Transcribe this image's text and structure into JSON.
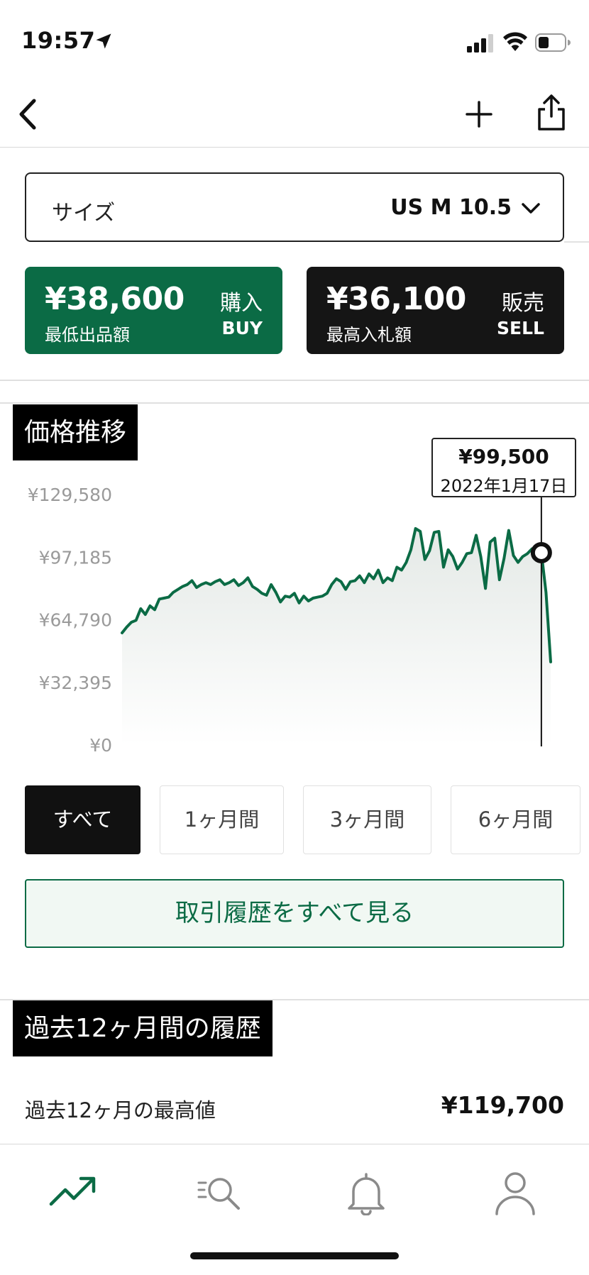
{
  "status_bar": {
    "time": "19:57"
  },
  "size_selector": {
    "label": "サイズ",
    "value": "US M 10.5"
  },
  "buy": {
    "price": "¥38,600",
    "caption": "最低出品額",
    "label_jp": "購入",
    "label_en": "BUY",
    "color": "#0b6b45"
  },
  "sell": {
    "price": "¥36,100",
    "caption": "最高入札額",
    "label_jp": "販売",
    "label_en": "SELL",
    "color": "#151515"
  },
  "price_section": {
    "title": "価格推移"
  },
  "tooltip": {
    "price": "¥99,500",
    "date": "2022年1月17日"
  },
  "chart_data": {
    "type": "area",
    "title": "",
    "xlabel": "",
    "ylabel": "",
    "y_ticks": [
      "¥129,580",
      "¥97,185",
      "¥64,790",
      "¥32,395",
      "¥0"
    ],
    "ylim": [
      0,
      129580
    ],
    "grid": false,
    "line_color": "#0b6b45",
    "series": [
      {
        "values": [
          58000,
          61000,
          63500,
          64500,
          70500,
          67500,
          72000,
          70000,
          75500,
          76000,
          76500,
          79000,
          80500,
          82000,
          83000,
          85000,
          81500,
          83000,
          84000,
          83000,
          84500,
          85500,
          83000,
          84000,
          85500,
          82500,
          84000,
          86500,
          82000,
          80500,
          78500,
          77500,
          83000,
          79000,
          74000,
          77000,
          76500,
          78500,
          73500,
          77000,
          74500,
          76000,
          76500,
          77000,
          78500,
          83000,
          86000,
          84500,
          80500,
          84500,
          85000,
          87500,
          84000,
          88500,
          86000,
          90500,
          84000,
          86500,
          85000,
          92000,
          90500,
          94500,
          101000,
          112000,
          110500,
          96000,
          100500,
          110000,
          110500,
          92000,
          101000,
          97500,
          91000,
          94500,
          99000,
          99500,
          108500,
          97500,
          81000,
          105000,
          107000,
          85500,
          96500,
          111000,
          98000,
          94500,
          97500,
          99000,
          101500,
          95500,
          99500,
          79000,
          43000
        ],
        "color": "#0b6b45"
      }
    ],
    "selected_point": {
      "price": "¥99,500",
      "date": "2022年1月17日",
      "value": 99500
    }
  },
  "period_tabs": [
    {
      "label": "すべて",
      "active": true
    },
    {
      "label": "1ヶ月間",
      "active": false
    },
    {
      "label": "3ヶ月間",
      "active": false
    },
    {
      "label": "6ヶ月間",
      "active": false
    }
  ],
  "history_button": {
    "label": "取引履歴をすべて見る"
  },
  "history_section": {
    "title": "過去12ヶ月間の履歴"
  },
  "stats": [
    {
      "label": "過去12ヶ月の最高値",
      "value": "¥119,700"
    }
  ],
  "tab_bar": {
    "items": [
      {
        "icon": "trend-icon",
        "active": true,
        "color": "#0b6b45"
      },
      {
        "icon": "search-icon",
        "active": false
      },
      {
        "icon": "bell-icon",
        "active": false
      },
      {
        "icon": "user-icon",
        "active": false
      }
    ]
  }
}
